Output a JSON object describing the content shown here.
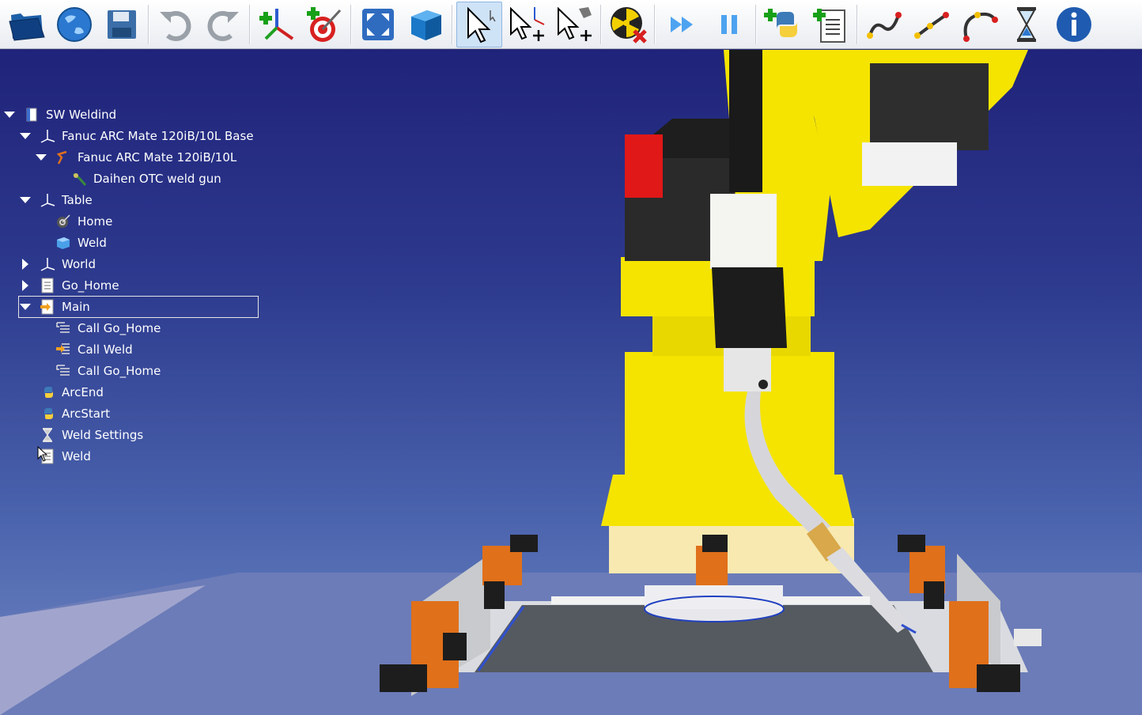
{
  "toolbar": {
    "buttons": [
      {
        "name": "open-folder-icon",
        "tooltip": ""
      },
      {
        "name": "online-library-icon",
        "tooltip": ""
      },
      {
        "name": "save-icon",
        "tooltip": ""
      },
      {
        "name": "undo-icon",
        "tooltip": ""
      },
      {
        "name": "redo-icon",
        "tooltip": ""
      },
      {
        "name": "add-reference-frame-icon",
        "tooltip": ""
      },
      {
        "name": "add-target-icon",
        "tooltip": ""
      },
      {
        "name": "fit-all-icon",
        "tooltip": ""
      },
      {
        "name": "cube-view-icon",
        "tooltip": ""
      },
      {
        "name": "select-icon",
        "tooltip": "",
        "active": true
      },
      {
        "name": "move-reference-frame-icon",
        "tooltip": ""
      },
      {
        "name": "move-tool-frame-icon",
        "tooltip": ""
      },
      {
        "name": "collision-check-icon",
        "tooltip": ""
      },
      {
        "name": "fast-simulation-icon",
        "tooltip": ""
      },
      {
        "name": "pause-icon",
        "tooltip": ""
      },
      {
        "name": "add-python-program-icon",
        "tooltip": ""
      },
      {
        "name": "add-program-icon",
        "tooltip": ""
      },
      {
        "name": "move-joint-icon",
        "tooltip": ""
      },
      {
        "name": "move-linear-icon",
        "tooltip": ""
      },
      {
        "name": "move-circular-icon",
        "tooltip": ""
      },
      {
        "name": "pause-instruction-icon",
        "tooltip": ""
      },
      {
        "name": "info-icon",
        "tooltip": ""
      }
    ]
  },
  "tree": {
    "items": [
      {
        "label": "SW Weldind",
        "level": 0,
        "expanded": true,
        "icon": "station-icon"
      },
      {
        "label": "Fanuc ARC Mate 120iB/10L Base",
        "level": 1,
        "expanded": true,
        "icon": "frame-icon"
      },
      {
        "label": "Fanuc ARC Mate 120iB/10L",
        "level": 2,
        "expanded": true,
        "icon": "robot-icon"
      },
      {
        "label": "Daihen OTC weld gun",
        "level": 3,
        "icon": "weld-gun-icon"
      },
      {
        "label": "Table",
        "level": 1,
        "expanded": true,
        "icon": "frame-icon"
      },
      {
        "label": "Home",
        "level": 2,
        "icon": "target-icon"
      },
      {
        "label": "Weld",
        "level": 2,
        "icon": "object-icon"
      },
      {
        "label": "World",
        "level": 1,
        "expanded": false,
        "icon": "frame-icon"
      },
      {
        "label": "Go_Home",
        "level": 1,
        "expanded": false,
        "icon": "program-icon"
      },
      {
        "label": "Main",
        "level": 1,
        "expanded": true,
        "icon": "main-program-icon",
        "selected": true
      },
      {
        "label": "Call Go_Home",
        "level": 2,
        "icon": "call-instruction-icon"
      },
      {
        "label": "Call Weld",
        "level": 2,
        "icon": "call-highlight-icon"
      },
      {
        "label": "Call Go_Home",
        "level": 2,
        "icon": "call-instruction-icon"
      },
      {
        "label": "ArcEnd",
        "level": 1,
        "icon": "python-script-icon"
      },
      {
        "label": "ArcStart",
        "level": 1,
        "icon": "python-script-icon"
      },
      {
        "label": "Weld Settings",
        "level": 1,
        "icon": "settings-icon"
      },
      {
        "label": "Weld",
        "level": 1,
        "icon": "program-icon"
      }
    ]
  },
  "colors": {
    "robot_yellow": "#f5e400",
    "background_top": "#20237a",
    "background_bottom": "#7188c2",
    "fixture_orange": "#e0701a"
  }
}
